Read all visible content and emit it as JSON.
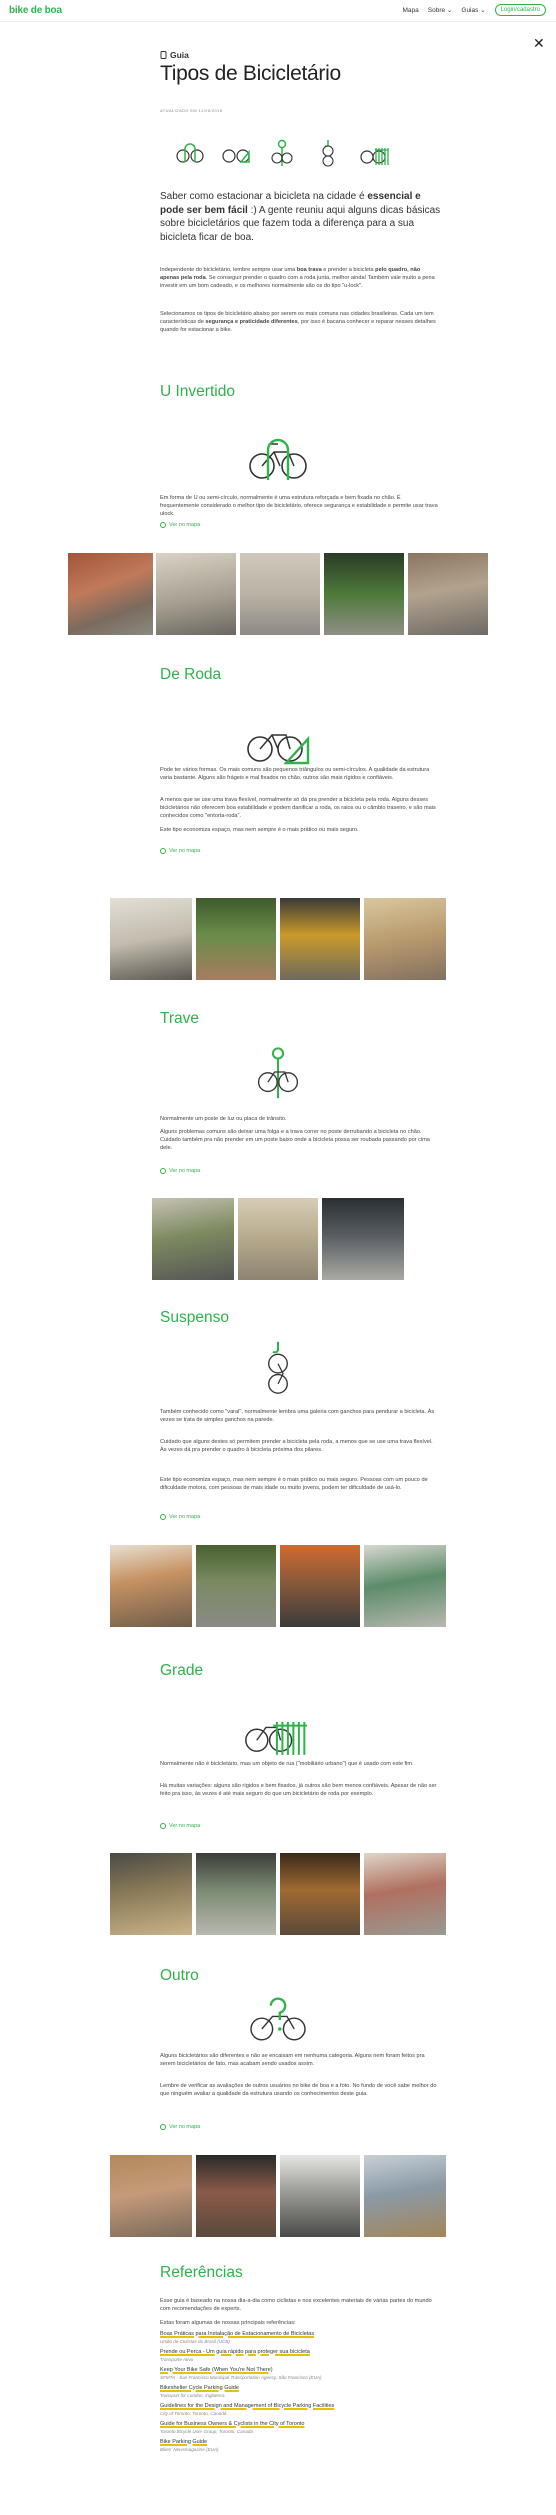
{
  "nav": {
    "logo": "bike de boa",
    "links": [
      "Mapa",
      "Sobre ⌄",
      "Guias ⌄"
    ],
    "login": "Login/cadastro"
  },
  "header": {
    "kicker": "Guia",
    "title": "Tipos de Bicicletário",
    "updated": "ATUALIZADO EM 11/05/2018"
  },
  "intro": {
    "lead_a": "Saber como estacionar a bicicleta na cidade é ",
    "lead_b": "essencial e pode ser bem fácil",
    "lead_c": " :) A gente reuniu aqui alguns dicas básicas sobre bicicletários que fazem toda a diferença para a sua bicicleta ficar de boa.",
    "p1_a": "Independente do bicicletário, lembre sempre usar uma ",
    "p1_b": "boa trava",
    "p1_c": " e prender a bicicleta ",
    "p1_d": "pelo quadro, não apenas pela roda",
    "p1_e": ". Se conseguir prender o quadro com a roda junta, melhor ainda! Também vale muito a pena investir em um bom cadeado, e os melhores normalmente são os do tipo \"u-lock\".",
    "p2_a": "Selecionamos os tipos de bicicletário abaixo por serem os mais comuns nas cidades brasileiras. Cada um tem características de ",
    "p2_b": "segurança e praticidade diferentes",
    "p2_c": ", por isso é bacana conhecer e reparar nesses detalhes quando for estacionar a bike."
  },
  "map_link": "Ver no mapa",
  "sections": [
    {
      "title": "U Invertido",
      "paras": [
        "Em forma de U ou semi-círculo, normalmente é uma estrutura reforçada e bem fixada no chão. É frequentemente considerado o melhor tipo de bicicletário, oferece segurança e estabilidade e permite usar trava ulock."
      ]
    },
    {
      "title": "De Roda",
      "paras": [
        "Pode ter vários formas. Os mais comuns são pequenos triângulos ou semi-círculos. A qualidade da estrutura varia bastante. Alguns são frágeis e mal fixados no chão, outros são mais rígidos e confiáveis.",
        "A menos que se use uma trava flexível, normalmente só dá pra prender a bicicleta pela roda. Alguns desses bicicletários não oferecem boa estabilidade e podem danificar a roda, os raios ou o câmbio traseiro, e são mais conhecidos como \"entorta-roda\".",
        "Este tipo economiza espaço, mas nem sempre é o mais prático ou mais seguro."
      ]
    },
    {
      "title": "Trave",
      "paras": [
        "Normalmente um poste de luz ou placa de trânsito.",
        "Alguns problemas comuns são deixar uma folga e a trava correr no poste derrubando a bicicleta no chão. Cuidado também pra não prender em um poste baixo onde a bicicleta possa ser roubada passando por cima dele."
      ]
    },
    {
      "title": "Suspenso",
      "paras": [
        "Também conhecido como \"varal\", normalmente lembra uma galeria com ganchos para pendurar a bicicleta. Às vezes se trata de simples ganchos na parede.",
        "Cuidado que alguns destes só permitem prender a bicicleta pela roda, a menos que se use uma trava flexível. Às vezes dá pra prender o quadro à bicicleta próxima dos pilares.",
        "Este tipo economiza espaço, mas nem sempre é o mais prático ou mais seguro. Pessoas com um pouco de dificuldade motora, com pessoas de mais idade ou muito jovens, podem ter dificuldade de usá-lo."
      ]
    },
    {
      "title": "Grade",
      "paras": [
        "Normalmente não é bicicletário, mas um objeto de rua (\"mobiliário urbano\") que é usado com este fim.",
        "Há muitas variações: alguns são rígidos e bem fixados, já outros são bem menos confiáveis. Apesar de não ser feito pra isso, às vezes é até mais seguro do que um bicicletário de roda por exemplo."
      ]
    },
    {
      "title": "Outro",
      "paras": [
        "Alguns bicicletários são diferentes e não se encaixam em nenhuma categoria. Alguns nem foram feitos pra serem bicicletários de fato, mas acabam sendo usados assim.",
        "Lembre de verificar as avaliações de outros usuários no bike de boa e a foto. No fundo de você sabe melhor do que ninguém avaliar a qualidade da estrutura usando os conhecimentos deste guia."
      ]
    }
  ],
  "references": {
    "title": "Referências",
    "p1": "Esse guia é baseado na nossa dia-a-dia como ciclistas e nos excelentes materiais de várias partes do mundo com recomendações de experts.",
    "p2": "Estas foram algumas de nossas principais referências:",
    "items": [
      {
        "title": "Boas Práticas para Instalação de Estacionamento de Bicicletas",
        "source": "União de Ciclistas do Brasil (UCB)"
      },
      {
        "title": "Prende ou Perca - Um guia rápido para proteger sua bicicleta",
        "source": "Transporte Ativo"
      },
      {
        "title": "Keep Your Bike Safe (When You're Not There)",
        "source": "SFMTA - San Francisco Municipal Transportation Agency, São Francisco (EUA)"
      },
      {
        "title": "Bikeshelter Cycle Parking Guide",
        "source": "Transport for London, Inglaterra"
      },
      {
        "title": "Guidelines for the Design and Management of Bicycle Parking Facilities",
        "source": "City of Toronto, Toronto, Canadá"
      },
      {
        "title": "Guide for Business Owners & Cyclists in the City of Toronto",
        "source": "Toronto Bicycle User Group, Toronto, Canadá"
      },
      {
        "title": "Bike Parking Guide",
        "source": "Bikes' Newsmagazine (EUA)"
      }
    ]
  },
  "colors": {
    "accent": "#2fb34a",
    "highlight": "#e6c300"
  }
}
